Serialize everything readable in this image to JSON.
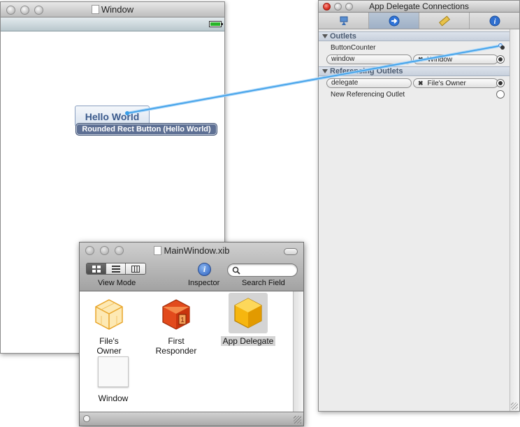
{
  "window": {
    "title": "Window",
    "hello_button_label": "Hello World",
    "button_caption": "Rounded Rect Button (Hello World)"
  },
  "inspector": {
    "title": "App Delegate Connections",
    "tabs": [
      {
        "icon": "attributes-icon"
      },
      {
        "icon": "connections-icon"
      },
      {
        "icon": "size-ruler-icon"
      },
      {
        "icon": "identity-info-icon"
      }
    ],
    "outlets_header": "Outlets",
    "outlets": [
      {
        "name": "ButtonCounter",
        "target": "",
        "connected": true
      },
      {
        "name": "window",
        "target": "Window",
        "connected": true
      }
    ],
    "referencing_header": "Referencing Outlets",
    "referencing": [
      {
        "name": "delegate",
        "target": "File's Owner",
        "connected": true
      },
      {
        "name": "New Referencing Outlet",
        "target": "",
        "connected": false
      }
    ]
  },
  "document": {
    "title": "MainWindow.xib",
    "view_mode_label": "View Mode",
    "inspector_label": "Inspector",
    "search_label": "Search Field",
    "search_value": "",
    "objects": [
      {
        "label": "File's Owner",
        "icon": "files-owner-cube-icon",
        "selected": false
      },
      {
        "label": "First Responder",
        "icon": "first-responder-cube-icon",
        "selected": false
      },
      {
        "label": "App Delegate",
        "icon": "app-delegate-cube-icon",
        "selected": true
      },
      {
        "label": "Window",
        "icon": "window-object-icon",
        "selected": false
      }
    ]
  },
  "colors": {
    "connection_line": "#3a9ee8",
    "caption_bg": "#5e7094",
    "selected_tab": "#9eb0c6"
  }
}
